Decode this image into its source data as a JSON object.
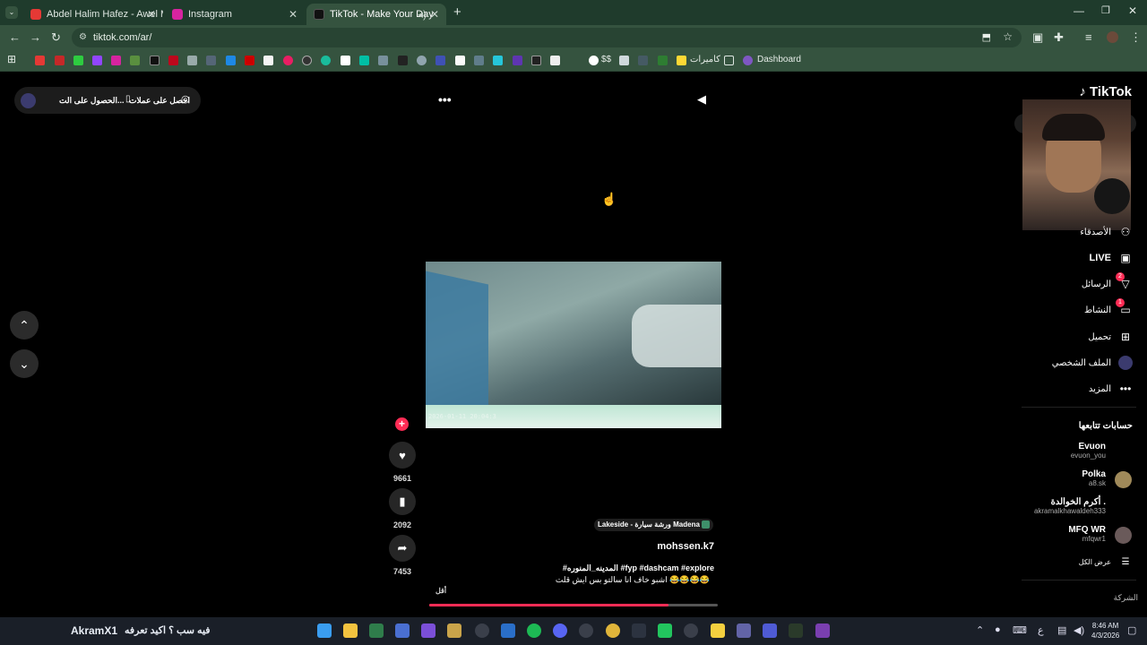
{
  "tabs": [
    {
      "title": "Abdel Halim Hafez - Awel Mara",
      "color": "#e53935"
    },
    {
      "title": "Instagram",
      "color": "#d6249f"
    },
    {
      "title": "TikTok - Make Your Day",
      "color": "#111111"
    }
  ],
  "address": "tiktok.com/ar/",
  "bookmarks": {
    "cameras": "كاميرات",
    "dollar": "$$",
    "dashboard": "Dashboard"
  },
  "top_controls": {
    "get_coins": "احصل على عملات",
    "get_app": "الحصول على الت..."
  },
  "brand": "TikTok",
  "video": {
    "timestamp": "2026-01-11 20:04:3",
    "author": "mohssen.k7",
    "location": "Lakeside - ورشة سيارة Madena",
    "hashtags": "#المدينه_المنوره #fyp #dashcam #explore",
    "caption": "اشبو خاف انا سالتو بس ايش قلت 😂😂😂😂",
    "less": "أقل",
    "progress": 0.83
  },
  "actions": {
    "likes": "9661",
    "saves": "2092",
    "shares": "7453"
  },
  "sidebar": {
    "following_label": "الأصدقاء",
    "live": "LIVE",
    "messages": "الرسائل",
    "messages_badge": "2",
    "activity": "النشاط",
    "activity_badge": "1",
    "upload": "تحميل",
    "profile": "الملف الشخصي",
    "more": "المزيد",
    "followed_title": "حسابات تتابعها",
    "accounts": [
      {
        "name": "Evuon",
        "handle": "evuon_you"
      },
      {
        "name": "Polka",
        "handle": "a8.sk"
      },
      {
        "name": "أكرم الخوالدة .",
        "handle": "akramalkhawaldeh333"
      },
      {
        "name": "MFQ WR",
        "handle": "mfqwr1"
      }
    ],
    "see_all": "عرض الكل",
    "company": "الشركة"
  },
  "taskbar": {
    "left_text": "فيه سب ؟ اكيد تعرفه",
    "left_name": "AkramX1",
    "lang": "ع",
    "time": "8:46 AM",
    "date": "4/3/2026"
  }
}
